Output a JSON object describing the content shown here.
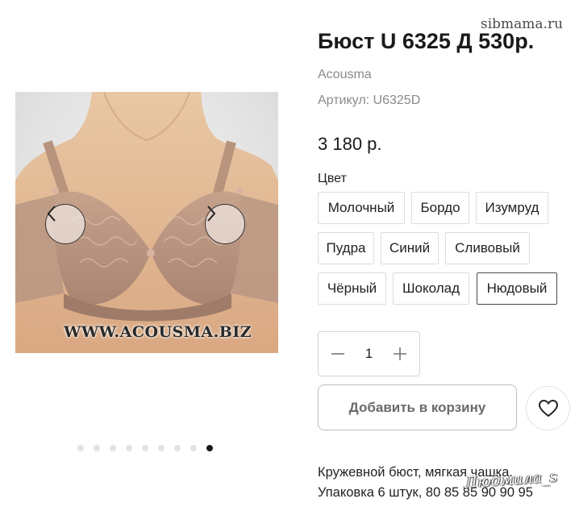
{
  "watermark": {
    "top": "sibmama.ru",
    "image": "WWW.ACOUSMA.BIZ",
    "signature": "Людмила_s"
  },
  "gallery": {
    "prev_icon": "chevron-left-icon",
    "next_icon": "chevron-right-icon",
    "dot_count": 9,
    "active_dot": 9
  },
  "product": {
    "title": "Бюст U 6325 Д 530р.",
    "brand": "Acousma",
    "sku": "Артикул: U6325D",
    "price": "3 180 р.",
    "color_label": "Цвет",
    "colors": [
      "Молочный",
      "Бордо",
      "Изумруд",
      "Пудра",
      "Синий",
      "Сливовый",
      "Чёрный",
      "Шоколад",
      "Нюдовый"
    ],
    "selected_color": "Нюдовый"
  },
  "quantity": {
    "value": "1",
    "minus_icon": "minus-icon",
    "plus_icon": "plus-icon"
  },
  "cart": {
    "add_label": "Добавить в корзину",
    "favorite_icon": "heart-icon"
  },
  "description": {
    "line1": "Кружевной бюст, мягкая чашка.",
    "line2": "Упаковка 6 штук, 80 85 85 90 90 95"
  }
}
